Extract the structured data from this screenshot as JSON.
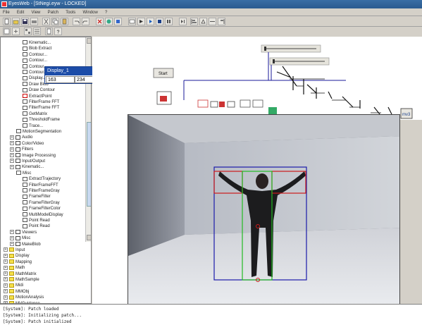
{
  "window": {
    "title": "EyesWeb - [StNegi.eyw - LOCKED]"
  },
  "menu": {
    "items": [
      "File",
      "Edit",
      "View",
      "Patch",
      "Tools",
      "Window",
      "?"
    ]
  },
  "tree": {
    "items": [
      {
        "label": "Kinematic..."
      },
      {
        "label": "Blob Extract"
      },
      {
        "label": "Contour..."
      },
      {
        "label": "Contour..."
      },
      {
        "label": "Contour..."
      },
      {
        "label": "Contour..."
      },
      {
        "label": "Display..."
      },
      {
        "label": "Draw Blob"
      },
      {
        "label": "Draw Contour"
      },
      {
        "label": "ExtractPoint"
      },
      {
        "label": "FilterFrame FFT"
      },
      {
        "label": "FilterFrame FFT"
      },
      {
        "label": "GetMatrix"
      },
      {
        "label": "ThresholdFrame"
      },
      {
        "label": "Trace..."
      },
      {
        "label": "MotionSegmentation"
      },
      {
        "label": "Audio"
      },
      {
        "label": "Color/Video"
      },
      {
        "label": "Filters"
      },
      {
        "label": "Image Processing"
      },
      {
        "label": "Input/Output"
      },
      {
        "label": "Kinematic..."
      },
      {
        "label": "Misc"
      },
      {
        "label": "ExtractTrajectory"
      },
      {
        "label": "FilterFrameFFT"
      },
      {
        "label": "FilterFrameGray"
      },
      {
        "label": "FrameFilter"
      },
      {
        "label": "FrameFilterGray"
      },
      {
        "label": "FrameFilterColor"
      },
      {
        "label": "MultiModelDisplay"
      },
      {
        "label": "Point Read"
      },
      {
        "label": "Point Read"
      },
      {
        "label": "Viewers"
      },
      {
        "label": "Misc"
      },
      {
        "label": "MakeBlob"
      },
      {
        "label": "Input"
      },
      {
        "label": "Display"
      },
      {
        "label": "Mapping"
      },
      {
        "label": "Math"
      },
      {
        "label": "MathMatrix"
      },
      {
        "label": "MathSample"
      },
      {
        "label": "Midi"
      },
      {
        "label": "MMObj"
      },
      {
        "label": "MotionAnalysis"
      },
      {
        "label": "MVGuidance"
      }
    ]
  },
  "display_popup": {
    "title": "Display_1",
    "x": "163",
    "y": "234"
  },
  "canvas": {
    "start_button": "Start",
    "module_right": "mv3"
  },
  "console": {
    "lines": [
      "[System]: Patch loaded",
      "[System]: Initializing patch...",
      "[System]: Patch initialized"
    ]
  },
  "colors": {
    "bbox_outer": "#1a1aaa",
    "bbox_arms": "#cc1a1a",
    "bbox_torso": "#22bb22"
  }
}
